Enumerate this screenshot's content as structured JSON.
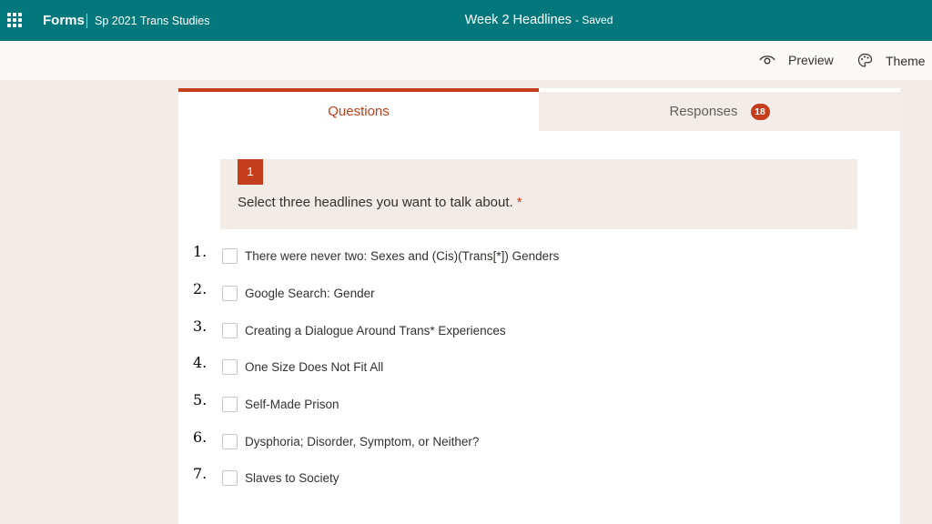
{
  "header": {
    "app_name": "Forms",
    "group_name": "Sp 2021 Trans Studies",
    "doc_title": "Week 2 Headlines",
    "save_status": "- Saved"
  },
  "commands": {
    "preview_label": "Preview",
    "theme_label": "Theme"
  },
  "tabs": {
    "questions_label": "Questions",
    "responses_label": "Responses",
    "responses_count": "18"
  },
  "question": {
    "number": "1",
    "text": "Select three headlines you want to talk about.",
    "required_marker": "*"
  },
  "options": [
    {
      "num": "1.",
      "label": "There were never two: Sexes and (Cis)(Trans[*]) Genders"
    },
    {
      "num": "2.",
      "label": "Google Search: Gender"
    },
    {
      "num": "3.",
      "label": "Creating a Dialogue Around Trans* Experiences"
    },
    {
      "num": "4.",
      "label": "One Size Does Not Fit All"
    },
    {
      "num": "5.",
      "label": "Self-Made Prison"
    },
    {
      "num": "6.",
      "label": "Dysphoria; Disorder, Symptom, or Neither?"
    },
    {
      "num": "7.",
      "label": "Slaves to Society"
    }
  ],
  "colors": {
    "brand": "#03787c",
    "accent": "#c43e1c",
    "page_bg": "#f3ebe6"
  }
}
